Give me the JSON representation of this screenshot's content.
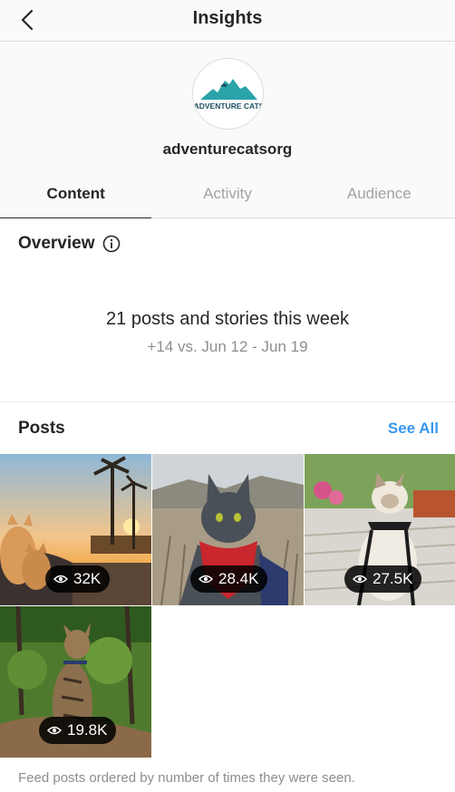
{
  "header": {
    "title": "Insights"
  },
  "profile": {
    "username": "adventurecatsorg",
    "avatar_text": "ADVENTURE CATS"
  },
  "tabs": [
    {
      "label": "Content",
      "active": true
    },
    {
      "label": "Activity",
      "active": false
    },
    {
      "label": "Audience",
      "active": false
    }
  ],
  "overview": {
    "title": "Overview",
    "summary": "21 posts and stories this week",
    "comparison": "+14 vs. Jun 12 - Jun 19"
  },
  "posts": {
    "title": "Posts",
    "see_all": "See All",
    "items": [
      {
        "views": "32K",
        "icon": "eye-icon"
      },
      {
        "views": "28.4K",
        "icon": "eye-icon"
      },
      {
        "views": "27.5K",
        "icon": "eye-icon"
      },
      {
        "views": "19.8K",
        "icon": "eye-icon"
      }
    ],
    "footnote": "Feed posts ordered by number of times they were seen."
  },
  "colors": {
    "accent": "#3897f0",
    "logo_teal": "#2aa3a9",
    "logo_dark": "#1d4f63"
  }
}
